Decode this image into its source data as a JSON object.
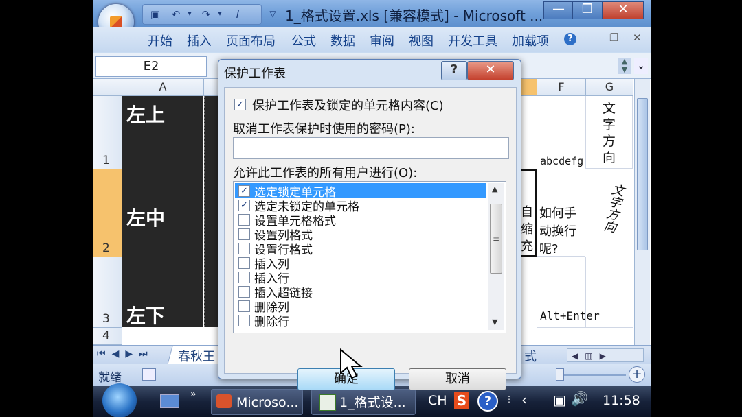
{
  "window": {
    "title": "1_格式设置.xls  [兼容模式] - Microsoft ...",
    "minimize_glyph": "—",
    "maximize_glyph": "❐",
    "close_glyph": "✕"
  },
  "ribbon": {
    "tabs": [
      "开始",
      "插入",
      "页面布局",
      "公式",
      "数据",
      "审阅",
      "视图",
      "开发工具",
      "加载项"
    ],
    "help_glyph": "?",
    "min_glyph": "—",
    "restore_glyph": "❐",
    "close_glyph": "✕"
  },
  "namebox": {
    "value": "E2"
  },
  "sheet": {
    "columns": [
      "A",
      "F",
      "G"
    ],
    "rows": [
      "1",
      "2",
      "3",
      "4"
    ],
    "cells": {
      "a1": "左上",
      "a2": "左中",
      "a3": "左下",
      "e2_fragment": "自\n缩\n充",
      "f1": "abcdefg",
      "f2": "如何手\n动换行\n呢?",
      "f3": "Alt+Enter",
      "g1": "文\n字\n方\n向",
      "g2": "文字方向"
    },
    "tab_visible": "春秋王",
    "tab_right_fragment": "式"
  },
  "status": {
    "ready": "就绪"
  },
  "dialog": {
    "title": "保护工作表",
    "help_glyph": "?",
    "close_glyph": "✕",
    "protect_checkbox_label": "保护工作表及锁定的单元格内容(C)",
    "protect_checked": true,
    "password_label": "取消工作表保护时使用的密码(P):",
    "password_value": "",
    "allow_label": "允许此工作表的所有用户进行(O):",
    "options": [
      {
        "label": "选定锁定单元格",
        "checked": true,
        "selected": true
      },
      {
        "label": "选定未锁定的单元格",
        "checked": true,
        "selected": false
      },
      {
        "label": "设置单元格格式",
        "checked": false,
        "selected": false
      },
      {
        "label": "设置列格式",
        "checked": false,
        "selected": false
      },
      {
        "label": "设置行格式",
        "checked": false,
        "selected": false
      },
      {
        "label": "插入列",
        "checked": false,
        "selected": false
      },
      {
        "label": "插入行",
        "checked": false,
        "selected": false
      },
      {
        "label": "插入超链接",
        "checked": false,
        "selected": false
      },
      {
        "label": "删除列",
        "checked": false,
        "selected": false
      },
      {
        "label": "删除行",
        "checked": false,
        "selected": false
      }
    ],
    "ok_label": "确定",
    "cancel_label": "取消"
  },
  "taskbar": {
    "items": [
      "Microso...",
      "1_格式设..."
    ],
    "ime": "CH",
    "time": "11:58"
  }
}
